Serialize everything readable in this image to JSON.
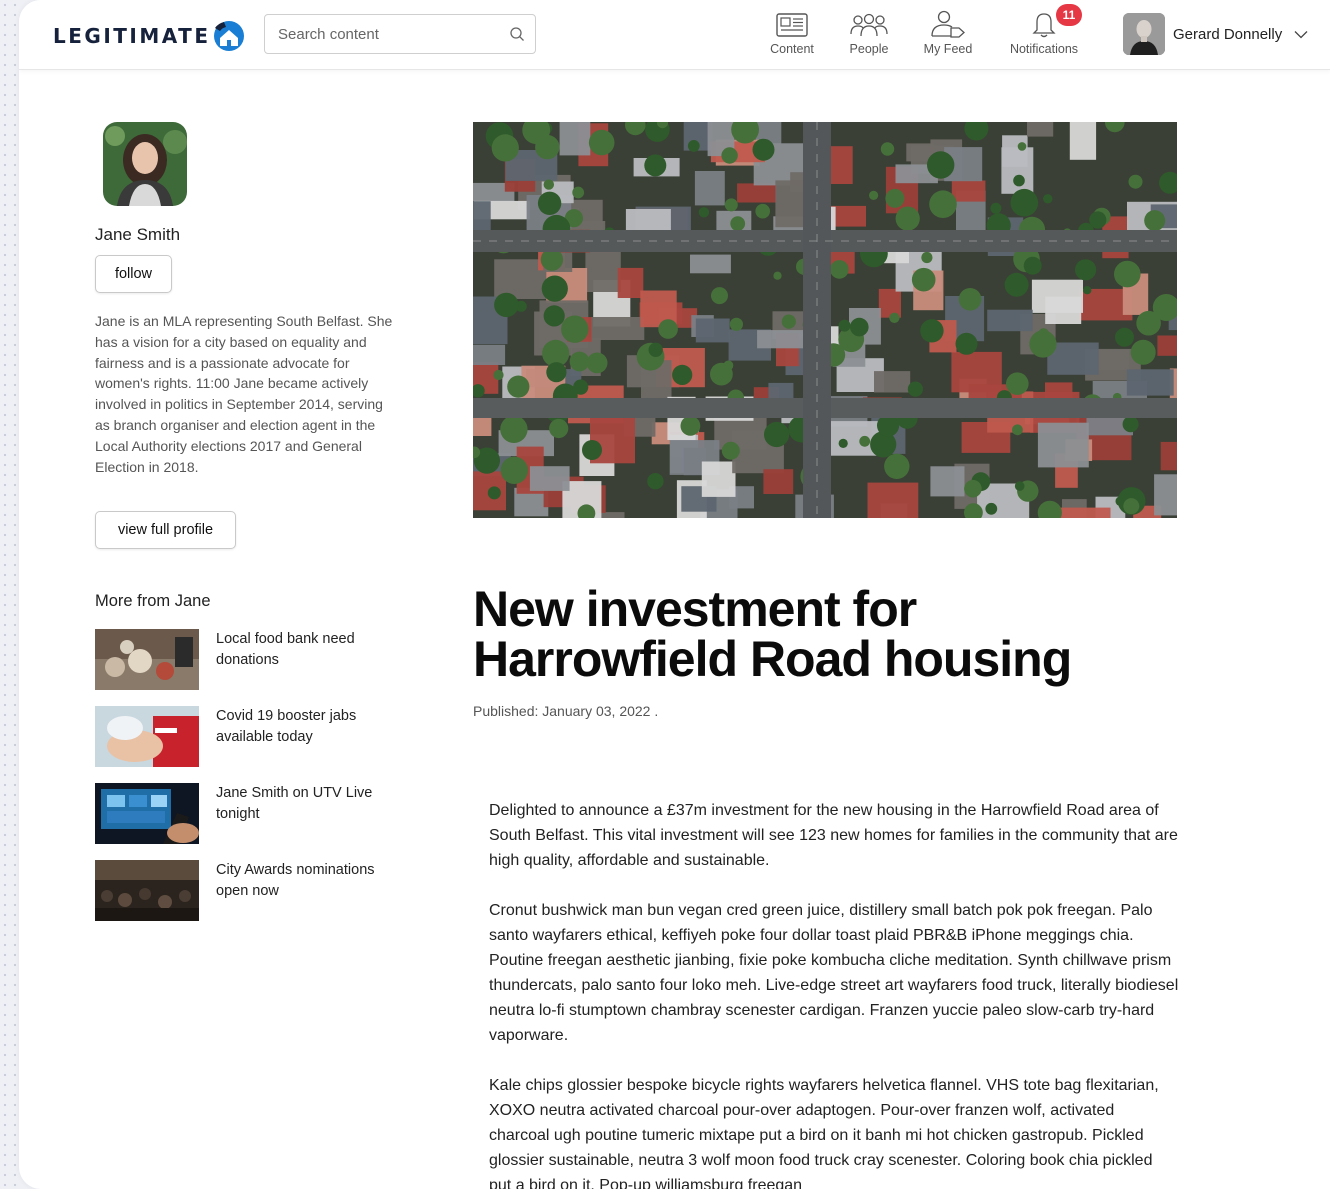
{
  "brand": {
    "logo_text": "LEGITIMATE"
  },
  "search": {
    "placeholder": "Search content"
  },
  "nav": [
    {
      "label": "Content",
      "icon": "newspaper-icon"
    },
    {
      "label": "People",
      "icon": "people-icon"
    },
    {
      "label": "My Feed",
      "icon": "user-tag-icon"
    },
    {
      "label": "Notifications",
      "icon": "bell-icon",
      "badge": "11"
    }
  ],
  "user": {
    "name": "Gerard Donnelly"
  },
  "profile": {
    "name": "Jane Smith",
    "follow_label": "follow",
    "bio": "Jane is an MLA representing South Belfast. She has a vision for a city based on equality and fairness and is a passionate advocate for women's rights. 11:00 Jane became actively involved in politics in September 2014, serving as branch organiser and election agent in the Local Authority elections 2017 and General Election in 2018.",
    "view_profile_label": "view full profile"
  },
  "more": {
    "title": "More from Jane",
    "items": [
      {
        "title": "Local food bank need donations"
      },
      {
        "title": "Covid 19 booster jabs available today"
      },
      {
        "title": "Jane Smith on UTV Live tonight"
      },
      {
        "title": "City Awards nominations open now"
      }
    ]
  },
  "article": {
    "title": "New investment for Harrowfield Road housing",
    "published": "Published: January 03, 2022 .",
    "paragraphs": [
      "Delighted to announce a £37m investment for the new housing in the Harrowfield Road area of South Belfast. This vital investment will see 123 new homes for families in the community that are high quality, affordable and sustainable.",
      "Cronut bushwick man bun vegan cred green juice, distillery small batch pok pok freegan. Palo santo wayfarers ethical, keffiyeh poke four dollar toast plaid PBR&B iPhone meggings chia. Poutine freegan aesthetic jianbing, fixie poke kombucha cliche meditation. Synth chillwave prism thundercats, palo santo four loko meh. Live-edge street art wayfarers food truck, literally biodiesel neutra lo-fi stumptown chambray scenester cardigan. Franzen yuccie paleo slow-carb try-hard vaporware.",
      "Kale chips glossier bespoke bicycle rights wayfarers helvetica flannel. VHS tote bag flexitarian, XOXO neutra activated charcoal pour-over adaptogen. Pour-over franzen wolf, activated charcoal ugh poutine tumeric mixtape put a bird on it banh mi hot chicken gastropub. Pickled glossier sustainable, neutra 3 wolf moon food truck cray scenester. Coloring book chia pickled put a bird on it. Pop-up williamsburg freegan"
    ]
  },
  "colors": {
    "brand_blue": "#1a7fd4",
    "badge_red": "#e53744",
    "logo_dark": "#16213b"
  }
}
